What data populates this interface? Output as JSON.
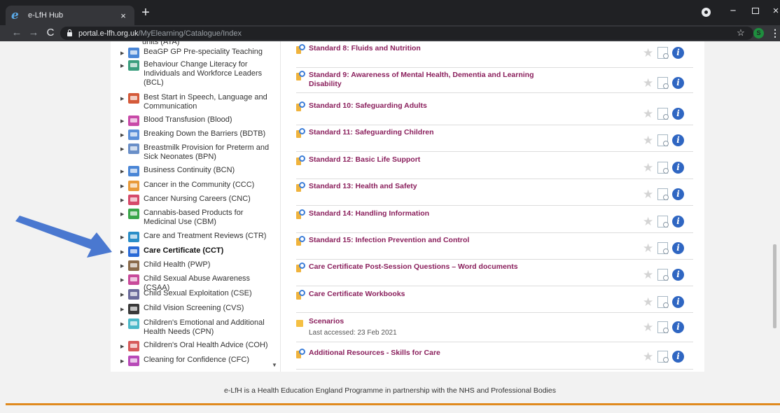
{
  "browser": {
    "tab_title": "e-LfH Hub",
    "tab_close": "×",
    "new_tab": "+",
    "url_host": "portal.e-lfh.org.uk",
    "url_path": "/MyElearning/Catalogue/Index",
    "profile_initial": "S",
    "minimize": "−",
    "close": "×"
  },
  "sidebar": {
    "items": [
      {
        "label": "units (ATA)",
        "icon": "catalogue-icon",
        "color": "#5b8fd8"
      },
      {
        "label": "BeaGP GP Pre-speciality Teaching",
        "icon": "catalogue-icon",
        "color": "#4a86d6"
      },
      {
        "label": "Behaviour Change Literacy for Individuals and Workforce Leaders (BCL)",
        "icon": "catalogue-icon",
        "color": "#3a9e7e"
      },
      {
        "label": "Best Start in Speech, Language and Communication",
        "icon": "catalogue-icon",
        "color": "#d45a3a"
      },
      {
        "label": "Blood Transfusion (Blood)",
        "icon": "catalogue-icon",
        "color": "#c84aa8"
      },
      {
        "label": "Breaking Down the Barriers (BDTB)",
        "icon": "catalogue-icon",
        "color": "#5b8fd8"
      },
      {
        "label": "Breastmilk Provision for Preterm and Sick Neonates (BPN)",
        "icon": "catalogue-icon",
        "color": "#6a8fc8"
      },
      {
        "label": "Business Continuity (BCN)",
        "icon": "catalogue-icon",
        "color": "#4a86d6"
      },
      {
        "label": "Cancer in the Community (CCC)",
        "icon": "catalogue-icon",
        "color": "#e89a3a"
      },
      {
        "label": "Cancer Nursing Careers (CNC)",
        "icon": "catalogue-icon",
        "color": "#d64a6a"
      },
      {
        "label": "Cannabis-based Products for Medicinal Use (CBM)",
        "icon": "catalogue-icon",
        "color": "#3aa64a"
      },
      {
        "label": "Care and Treatment Reviews (CTR)",
        "icon": "catalogue-icon",
        "color": "#2a8ec8"
      },
      {
        "label": "Care Certificate (CCT)",
        "icon": "catalogue-icon",
        "color": "#2a6ad6"
      },
      {
        "label": "Child Health (PWP)",
        "icon": "catalogue-icon",
        "color": "#8a6a4a"
      },
      {
        "label": "Child Sexual Abuse Awareness (CSAA)",
        "icon": "catalogue-icon",
        "color": "#c84a9a"
      },
      {
        "label": "Child Sexual Exploitation (CSE)",
        "icon": "catalogue-icon",
        "color": "#6a6a9a"
      },
      {
        "label": "Child Vision Screening (CVS)",
        "icon": "catalogue-icon",
        "color": "#3a3a3a"
      },
      {
        "label": "Children's Emotional and Additional Health Needs (CPN)",
        "icon": "catalogue-icon",
        "color": "#4ab8c8"
      },
      {
        "label": "Children's Oral Health Advice (COH)",
        "icon": "catalogue-icon",
        "color": "#d65a5a"
      },
      {
        "label": "Cleaning for Confidence (CFC)",
        "icon": "catalogue-icon",
        "color": "#b84ab8"
      }
    ]
  },
  "courses": [
    {
      "title": "Standard 8: Fluids and Nutrition",
      "subtitle": "",
      "icon": "learning-path-icon"
    },
    {
      "title": "Standard 9: Awareness of Mental Health, Dementia and Learning Disability",
      "subtitle": "",
      "icon": "learning-path-icon"
    },
    {
      "title": "Standard 10: Safeguarding Adults",
      "subtitle": "",
      "icon": "learning-path-icon"
    },
    {
      "title": "Standard 11: Safeguarding Children",
      "subtitle": "",
      "icon": "learning-path-icon"
    },
    {
      "title": "Standard 12: Basic Life Support",
      "subtitle": "",
      "icon": "learning-path-icon"
    },
    {
      "title": "Standard 13: Health and Safety",
      "subtitle": "",
      "icon": "learning-path-icon"
    },
    {
      "title": "Standard 14: Handling Information",
      "subtitle": "",
      "icon": "learning-path-icon"
    },
    {
      "title": "Standard 15: Infection Prevention and Control",
      "subtitle": "",
      "icon": "learning-path-icon"
    },
    {
      "title": "Care Certificate Post-Session Questions – Word documents",
      "subtitle": "",
      "icon": "learning-path-icon"
    },
    {
      "title": "Care Certificate Workbooks",
      "subtitle": "",
      "icon": "learning-path-icon"
    },
    {
      "title": "Scenarios",
      "subtitle": "Last accessed: 23 Feb 2021",
      "icon": "folder-icon"
    },
    {
      "title": "Additional Resources - Skills for Care",
      "subtitle": "",
      "icon": "learning-path-icon"
    }
  ],
  "actions": {
    "star": "★",
    "info": "i"
  },
  "footer": {
    "text": "e-LfH is a Health Education England Programme in partnership with the NHS and Professional Bodies",
    "accent_color": "#e08a1e"
  },
  "colors": {
    "course_title": "#8a1f5c",
    "info_button": "#2f66c2",
    "annotation_arrow": "#4a78d0"
  }
}
